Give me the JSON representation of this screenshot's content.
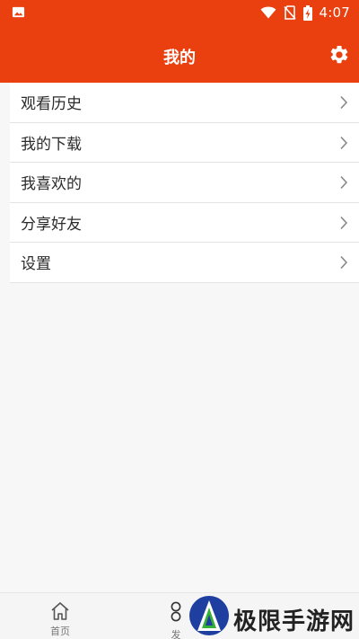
{
  "status_bar": {
    "time": "4:07",
    "icons": [
      "image-icon",
      "wifi-icon",
      "no-sim-icon",
      "battery-charging-icon"
    ]
  },
  "header": {
    "title": "我的",
    "settings_icon": "gear-icon"
  },
  "menu": {
    "items": [
      {
        "label": "观看历史"
      },
      {
        "label": "我的下载"
      },
      {
        "label": "我喜欢的"
      },
      {
        "label": "分享好友"
      },
      {
        "label": "设置"
      }
    ]
  },
  "bottom_nav": {
    "home_label": "首页",
    "discover_label": "发"
  },
  "watermark": {
    "text": "极限手游网"
  },
  "colors": {
    "brand": "#ea3f0f",
    "background": "#f7f7f7",
    "text": "#2b2b2b"
  }
}
